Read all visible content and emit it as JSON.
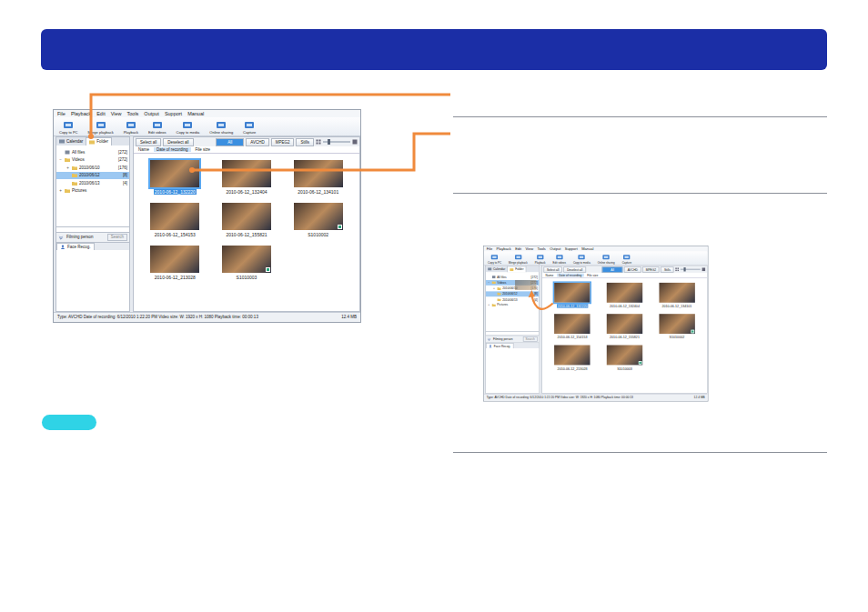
{
  "screenshots": [
    {
      "dragging": false,
      "menu": [
        "File",
        "Playback",
        "Edit",
        "View",
        "Tools",
        "Output",
        "Support",
        "Manual"
      ],
      "toolbar": [
        "Copy to PC",
        "Merge playback",
        "Playback",
        "Edit videos",
        "Copy to media",
        "Online sharing",
        "Capture"
      ],
      "tabs": [
        {
          "label": "Calendar",
          "selected": false
        },
        {
          "label": "Folder",
          "selected": true
        }
      ],
      "tree": [
        {
          "label": "All files",
          "count": "[272]",
          "toggle": "",
          "level": 0,
          "kind": "all",
          "expanded": false,
          "selected": false
        },
        {
          "label": "Videos",
          "count": "[272]",
          "toggle": "−",
          "level": 0,
          "kind": "folder",
          "expanded": true,
          "selected": false
        },
        {
          "label": "2010/06/10",
          "count": "[176]",
          "toggle": "+",
          "level": 1,
          "kind": "folder",
          "expanded": false,
          "selected": false
        },
        {
          "label": "2010/06/12",
          "count": "[8]",
          "toggle": "",
          "level": 1,
          "kind": "folder",
          "expanded": false,
          "selected": true
        },
        {
          "label": "2010/06/13",
          "count": "[4]",
          "toggle": "",
          "level": 1,
          "kind": "folder",
          "expanded": false,
          "selected": false
        },
        {
          "label": "Pictures",
          "count": "",
          "toggle": "+",
          "level": 0,
          "kind": "folder",
          "expanded": false,
          "selected": false
        }
      ],
      "face_panel": {
        "title": "Filming person",
        "button": "Search",
        "tab": "Face Recog."
      },
      "buttons": [
        "Select all",
        "Deselect all"
      ],
      "filters": [
        {
          "label": "All",
          "selected": true
        },
        {
          "label": "AVCHD",
          "selected": false
        },
        {
          "label": "MPEG2",
          "selected": false
        },
        {
          "label": "Stills",
          "selected": false
        }
      ],
      "zoom_level": 0.15,
      "sort": [
        {
          "label": "Name",
          "selected": false
        },
        {
          "label": "Date of recording",
          "selected": true
        },
        {
          "label": "File size",
          "selected": false
        }
      ],
      "thumbnails": [
        {
          "label": "2010-06-12_132220",
          "kind": "video",
          "selected": true
        },
        {
          "label": "2010-06-12_132404",
          "kind": "video",
          "selected": false
        },
        {
          "label": "2010-06-12_134101",
          "kind": "video",
          "selected": false
        },
        {
          "label": "2010-06-12_154153",
          "kind": "video",
          "selected": false
        },
        {
          "label": "2010-06-12_155821",
          "kind": "video",
          "selected": false
        },
        {
          "label": "S1010002",
          "kind": "still",
          "selected": false
        },
        {
          "label": "2010-06-12_213028",
          "kind": "video",
          "selected": false
        },
        {
          "label": "S1010003",
          "kind": "still",
          "selected": false
        }
      ],
      "status": "Type: AVCHD  Date of recording: 6/12/2010 1:22:20 PM  Video size: W: 1920 x H: 1080  Playback time: 00:00:13",
      "status_size": "12.4 MB"
    },
    {
      "dragging": true,
      "menu": [
        "File",
        "Playback",
        "Edit",
        "View",
        "Tools",
        "Output",
        "Support",
        "Manual"
      ],
      "toolbar": [
        "Copy to PC",
        "Merge playback",
        "Playback",
        "Edit videos",
        "Copy to media",
        "Online sharing",
        "Capture"
      ],
      "tabs": [
        {
          "label": "Calendar",
          "selected": false
        },
        {
          "label": "Folder",
          "selected": true
        }
      ],
      "tree": [
        {
          "label": "All files",
          "count": "[272]",
          "toggle": "",
          "level": 0,
          "kind": "all",
          "expanded": false,
          "selected": false
        },
        {
          "label": "Videos",
          "count": "[272]",
          "toggle": "−",
          "level": 0,
          "kind": "folder",
          "expanded": true,
          "selected": true
        },
        {
          "label": "2010/06/10",
          "count": "[176]",
          "toggle": "+",
          "level": 1,
          "kind": "folder",
          "expanded": false,
          "selected": false
        },
        {
          "label": "2010/06/12",
          "count": "[8]",
          "toggle": "",
          "level": 1,
          "kind": "folder",
          "expanded": false,
          "selected": true
        },
        {
          "label": "2010/06/13",
          "count": "[4]",
          "toggle": "",
          "level": 1,
          "kind": "folder",
          "expanded": false,
          "selected": false
        },
        {
          "label": "Pictures",
          "count": "",
          "toggle": "+",
          "level": 0,
          "kind": "folder",
          "expanded": false,
          "selected": false
        }
      ],
      "face_panel": {
        "title": "Filming person",
        "button": "Search",
        "tab": "Face Recog."
      },
      "buttons": [
        "Select all",
        "Deselect all"
      ],
      "filters": [
        {
          "label": "All",
          "selected": true
        },
        {
          "label": "AVCHD",
          "selected": false
        },
        {
          "label": "MPEG2",
          "selected": false
        },
        {
          "label": "Stills",
          "selected": false
        }
      ],
      "zoom_level": 0.15,
      "sort": [
        {
          "label": "Name",
          "selected": false
        },
        {
          "label": "Date of recording",
          "selected": true
        },
        {
          "label": "File size",
          "selected": false
        }
      ],
      "thumbnails": [
        {
          "label": "2010-06-12_132220",
          "kind": "video",
          "selected": true
        },
        {
          "label": "2010-06-12_132404",
          "kind": "video",
          "selected": false
        },
        {
          "label": "2010-06-12_134101",
          "kind": "video",
          "selected": false
        },
        {
          "label": "2010-06-12_154153",
          "kind": "video",
          "selected": false
        },
        {
          "label": "2010-06-12_155821",
          "kind": "video",
          "selected": false
        },
        {
          "label": "S1010002",
          "kind": "still",
          "selected": false
        },
        {
          "label": "2010-06-12_213028",
          "kind": "video",
          "selected": false
        },
        {
          "label": "S1010003",
          "kind": "still",
          "selected": false
        }
      ],
      "status": "Type: AVCHD  Date of recording: 6/12/2010 1:22:20 PM  Video size: W: 1920 x H: 1080  Playback time: 00:00:13",
      "status_size": "12.4 MB"
    }
  ]
}
